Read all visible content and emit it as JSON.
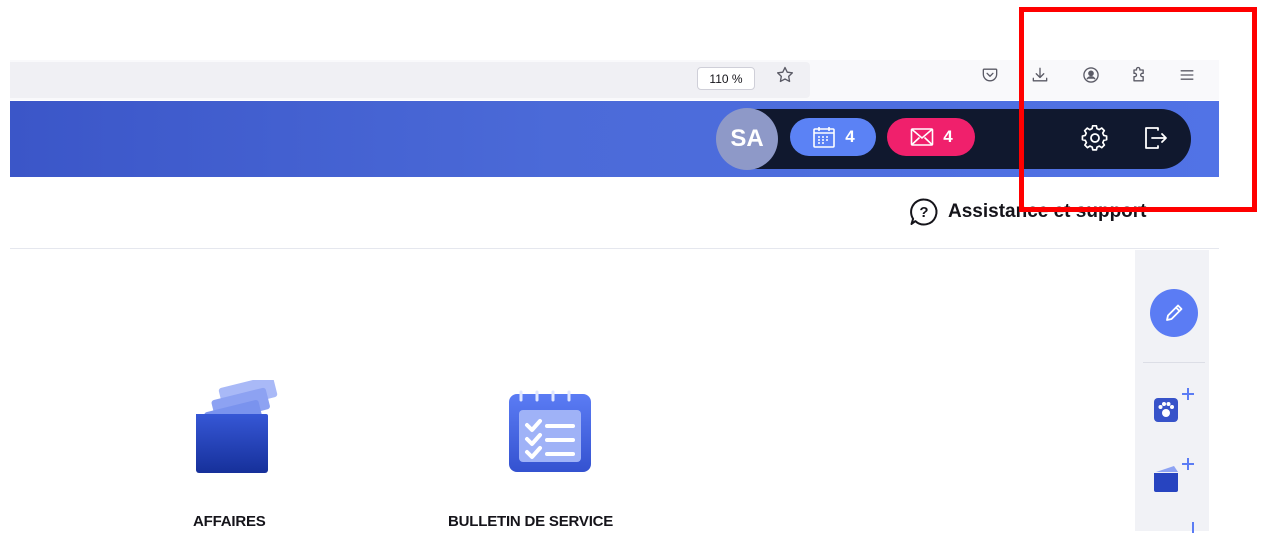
{
  "browser": {
    "zoom_label": "110 %",
    "icons": [
      "star-icon",
      "pocket-icon",
      "download-icon",
      "account-icon",
      "extensions-icon",
      "menu-icon"
    ]
  },
  "header": {
    "avatar_initials": "SA",
    "calendar_count": "4",
    "mail_count": "4",
    "icons": [
      "calendar-icon",
      "mail-icon",
      "settings-icon",
      "logout-icon"
    ],
    "colors": {
      "header_start": "#3b56c8",
      "header_end": "#5173e6",
      "pill": "#10182e",
      "calendar": "#5b82f5",
      "mail": "#f0206c"
    }
  },
  "support": {
    "label": "Assistance et support",
    "icon": "help-icon"
  },
  "rail": {
    "icons": [
      "pencil-icon",
      "add-pet-icon",
      "add-folder-icon"
    ]
  },
  "tiles": [
    {
      "label": "AFFAIRES",
      "icon": "folder-cards-icon"
    },
    {
      "label": "BULLETIN DE SERVICE",
      "icon": "checklist-calendar-icon"
    }
  ]
}
